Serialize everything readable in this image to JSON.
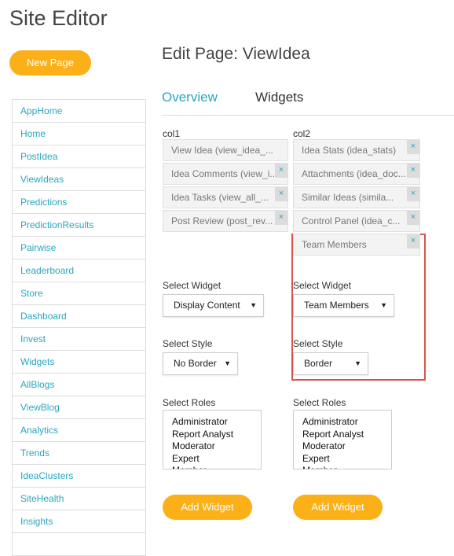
{
  "app": {
    "title": "Site Editor",
    "new_page": "New Page"
  },
  "sidebar": {
    "items": [
      "AppHome",
      "Home",
      "PostIdea",
      "ViewIdeas",
      "Predictions",
      "PredictionResults",
      "Pairwise",
      "Leaderboard",
      "Store",
      "Dashboard",
      "Invest",
      "Widgets",
      "AllBlogs",
      "ViewBlog",
      "Analytics",
      "Trends",
      "IdeaClusters",
      "SiteHealth",
      "Insights",
      ""
    ]
  },
  "main": {
    "title": "Edit Page: ViewIdea",
    "tabs": [
      {
        "label": "Overview",
        "active": false
      },
      {
        "label": "Widgets",
        "active": true
      }
    ],
    "col1": {
      "header": "col1",
      "widgets": [
        {
          "label": "View Idea (view_idea_...",
          "removable": false
        },
        {
          "label": "Idea Comments (view_i...",
          "removable": true
        },
        {
          "label": "Idea Tasks (view_all_...",
          "removable": true
        },
        {
          "label": "Post Review (post_rev...",
          "removable": true
        }
      ],
      "select_widget_label": "Select Widget",
      "select_widget_value": "Display Content",
      "select_style_label": "Select Style",
      "select_style_value": "No Border",
      "select_roles_label": "Select Roles",
      "roles": [
        "Administrator",
        "Report Analyst",
        "Moderator",
        "Expert",
        "Member"
      ],
      "add_label": "Add Widget"
    },
    "col2": {
      "header": "col2",
      "widgets": [
        {
          "label": "Idea Stats (idea_stats)",
          "removable": true
        },
        {
          "label": "Attachments (idea_doc...",
          "removable": true
        },
        {
          "label": "Similar Ideas (simila...",
          "removable": true
        },
        {
          "label": "Control Panel (idea_c...",
          "removable": true
        },
        {
          "label": "Team Members",
          "removable": true
        }
      ],
      "select_widget_label": "Select Widget",
      "select_widget_value": "Team Members",
      "select_style_label": "Select Style",
      "select_style_value": "Border",
      "select_roles_label": "Select Roles",
      "roles": [
        "Administrator",
        "Report Analyst",
        "Moderator",
        "Expert",
        "Member"
      ],
      "add_label": "Add Widget"
    },
    "remove_glyph": "×",
    "caret": "▼"
  },
  "colors": {
    "accent": "#fbb018",
    "link": "#2aa6c0",
    "highlight": "#d9534f"
  }
}
